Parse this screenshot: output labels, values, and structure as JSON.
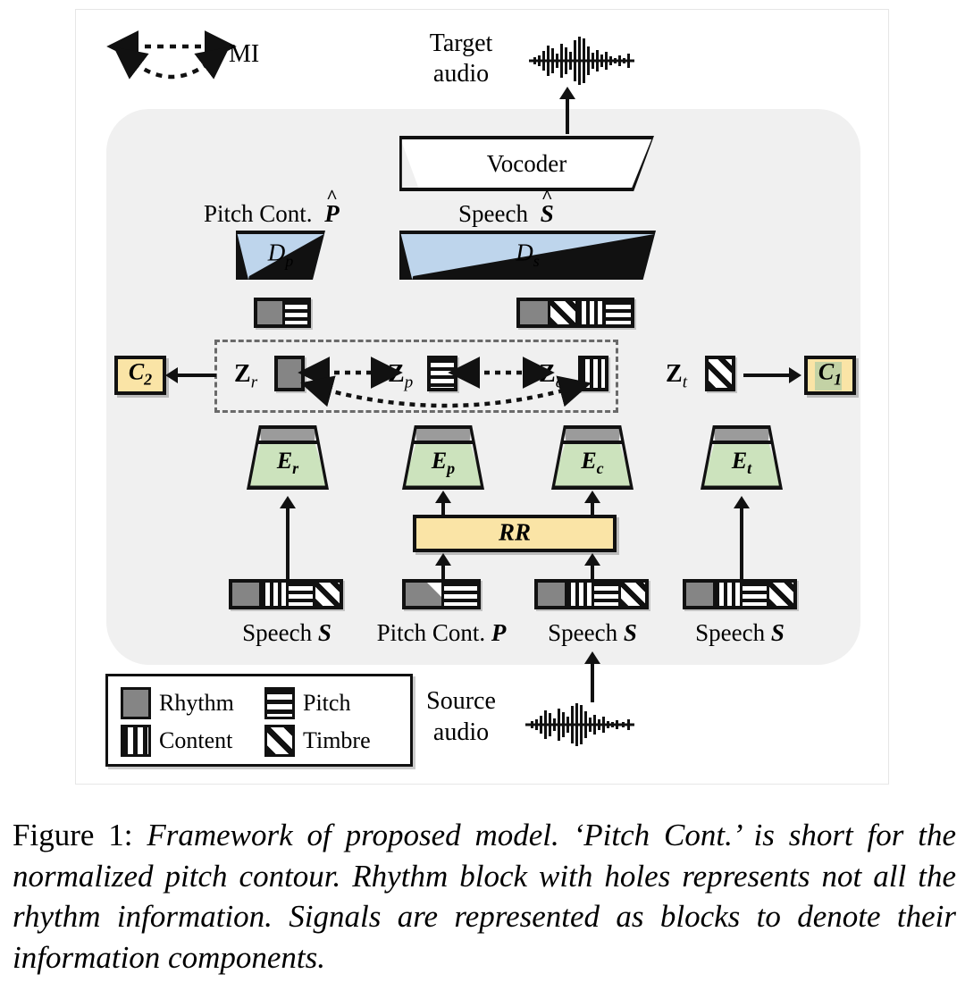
{
  "figure": {
    "caption_lead": "Figure 1:",
    "caption_body": "Framework of proposed model. ‘Pitch Cont.’ is short for the normalized pitch contour. Rhythm block with holes represents not all the rhythm information. Signals are represented as blocks to denote their information components."
  },
  "legend_mi": {
    "label": "MI"
  },
  "audio": {
    "target_label_line1": "Target",
    "target_label_line2": "audio",
    "source_label_line1": "Source",
    "source_label_line2": "audio"
  },
  "vocoder": {
    "label": "Vocoder"
  },
  "decoders": [
    {
      "id": "Dp",
      "label": "Dp",
      "output_label": "Pitch Cont. P̂"
    },
    {
      "id": "Ds",
      "label": "Ds",
      "output_label": "Speech Ŝ"
    }
  ],
  "decoder_labels": {
    "pitch_cont_hat": "Pitch Cont.",
    "pitch_cont_hat_sym": "P",
    "speech_hat": "Speech",
    "speech_hat_sym": "S"
  },
  "encoders": [
    {
      "id": "Er",
      "label": "Er",
      "base": "E",
      "sub": "r"
    },
    {
      "id": "Ep",
      "label": "Ep",
      "base": "E",
      "sub": "p"
    },
    {
      "id": "Ec",
      "label": "Ec",
      "base": "E",
      "sub": "c"
    },
    {
      "id": "Et",
      "label": "Et",
      "base": "E",
      "sub": "t"
    }
  ],
  "rr_block": {
    "label": "RR"
  },
  "classifiers": [
    {
      "id": "C2",
      "base": "C",
      "sub": "2"
    },
    {
      "id": "C1",
      "base": "C",
      "sub": "1"
    }
  ],
  "latents": [
    {
      "id": "Zr",
      "base": "Z",
      "sub": "r",
      "components": [
        "rhythm"
      ]
    },
    {
      "id": "Zp",
      "base": "Z",
      "sub": "p",
      "components": [
        "pitch"
      ]
    },
    {
      "id": "Zc",
      "base": "Z",
      "sub": "c",
      "components": [
        "content"
      ]
    },
    {
      "id": "Zt",
      "base": "Z",
      "sub": "t",
      "components": [
        "timbre"
      ]
    }
  ],
  "decoder_input_blocks": [
    {
      "for": "Dp",
      "components": [
        "rhythm",
        "pitch"
      ]
    },
    {
      "for": "Ds",
      "components": [
        "rhythm",
        "timbre",
        "content",
        "pitch"
      ]
    }
  ],
  "input_signals": [
    {
      "label_text": "Speech",
      "label_sym": "S",
      "components": [
        "rhythm",
        "content",
        "pitch",
        "timbre"
      ]
    },
    {
      "label_text": "Pitch Cont.",
      "label_sym": "P",
      "components": [
        "rhythm-hole",
        "pitch"
      ]
    },
    {
      "label_text": "Speech",
      "label_sym": "S",
      "components": [
        "rhythm",
        "content",
        "pitch",
        "timbre"
      ]
    },
    {
      "label_text": "Speech",
      "label_sym": "S",
      "components": [
        "rhythm",
        "content",
        "pitch",
        "timbre"
      ]
    }
  ],
  "legend": {
    "items": [
      {
        "key": "rhythm",
        "label": "Rhythm"
      },
      {
        "key": "pitch",
        "label": "Pitch"
      },
      {
        "key": "content",
        "label": "Content"
      },
      {
        "key": "timbre",
        "label": "Timbre"
      }
    ]
  },
  "colors": {
    "encoder_fill": "#cce3bd",
    "encoder_cap": "#9b9b9b",
    "decoder_fill": "#bed5ec",
    "accent_yellow": "#fae4a6",
    "classifier_tint": "#b9cfa4",
    "panel_bg": "#f0f0f0",
    "rhythm_gray": "#858585",
    "stroke": "#111111"
  }
}
